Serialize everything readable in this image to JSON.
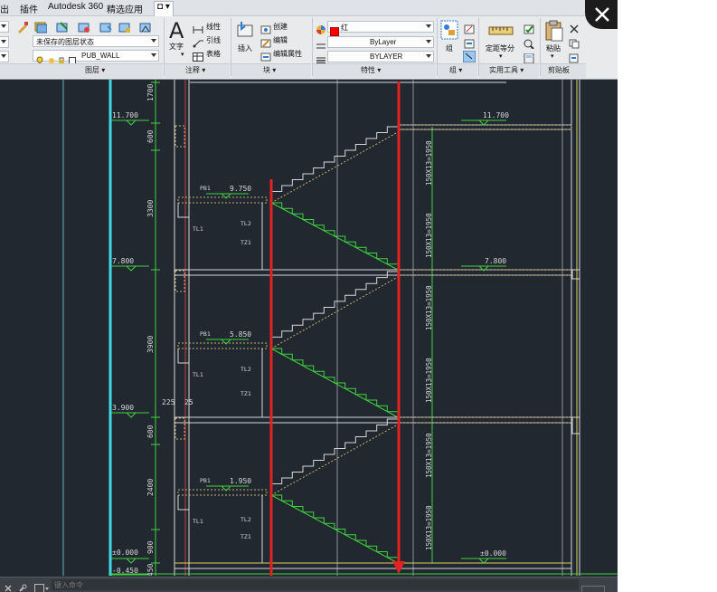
{
  "menubar": {
    "items": [
      "出",
      "插件",
      "Autodesk 360",
      "精选应用"
    ],
    "dropdown_glyph": "◘ ▾"
  },
  "ribbon": {
    "layers": {
      "state_value": "未保存的图层状态",
      "current_layer": "PUB_WALL",
      "panel_title": "图层 ▾"
    },
    "annotation": {
      "text_label": "文字",
      "linear_label": "线性",
      "leader_label": "引线",
      "table_label": "表格",
      "panel_title": "注释 ▾"
    },
    "block": {
      "insert_label": "插入",
      "create_label": "创建",
      "edit_label": "编辑",
      "edit_attr_label": "编辑属性",
      "panel_title": "块 ▾"
    },
    "properties": {
      "color_value": "红",
      "linetype_value": "ByLayer",
      "lineweight_value": "BYLAYER",
      "panel_title": "特性 ▾"
    },
    "groups": {
      "group_label": "组",
      "panel_title": "组 ▾"
    },
    "utilities": {
      "measure_label": "定距等分",
      "panel_title": "实用工具 ▾"
    },
    "clipboard": {
      "paste_label": "粘贴",
      "panel_title": "剪贴板"
    }
  },
  "drawing": {
    "dimensions": [
      "1700",
      "600",
      "3300",
      "3900",
      "600",
      "2400",
      "900",
      "450"
    ],
    "elevations": {
      "e11700_left": "11.700",
      "e11700_right": "11.700",
      "e9750": "9.750",
      "e7800_left": "7.800",
      "e7800_right": "7.800",
      "e5850": "5.850",
      "e3900": "3.900",
      "e1950": "1.950",
      "e0_left": "±0.000",
      "e0_right": "±0.000",
      "e_neg": "-0.450"
    },
    "labels": {
      "pb1_a": "PB1",
      "pb1_b": "PB1",
      "pb1_c": "PB1",
      "tl1_a": "TL1",
      "tl1_b": "TL1",
      "tl1_c": "TL1",
      "tl2_a": "TL2",
      "tl2_b": "TL2",
      "tl2_c": "TL2",
      "tz1_a": "TZ1",
      "tz1_b": "TZ1",
      "tz1_c": "TZ1",
      "dim225": "225",
      "dim25": "25"
    },
    "flights": [
      "150X13=1950",
      "150X13=1950",
      "150X13=1950",
      "150X13=1950",
      "150X13=1950",
      "150X13=1950"
    ]
  },
  "commandline": {
    "placeholder": "键入命令"
  },
  "colors": {
    "background": "#212830",
    "annotation_red": "#e52222",
    "dimension_green": "#3fd23f",
    "grid_cyan": "#41d8e8",
    "wall_line": "#d8d8d8",
    "hatch": "#c8b070"
  }
}
